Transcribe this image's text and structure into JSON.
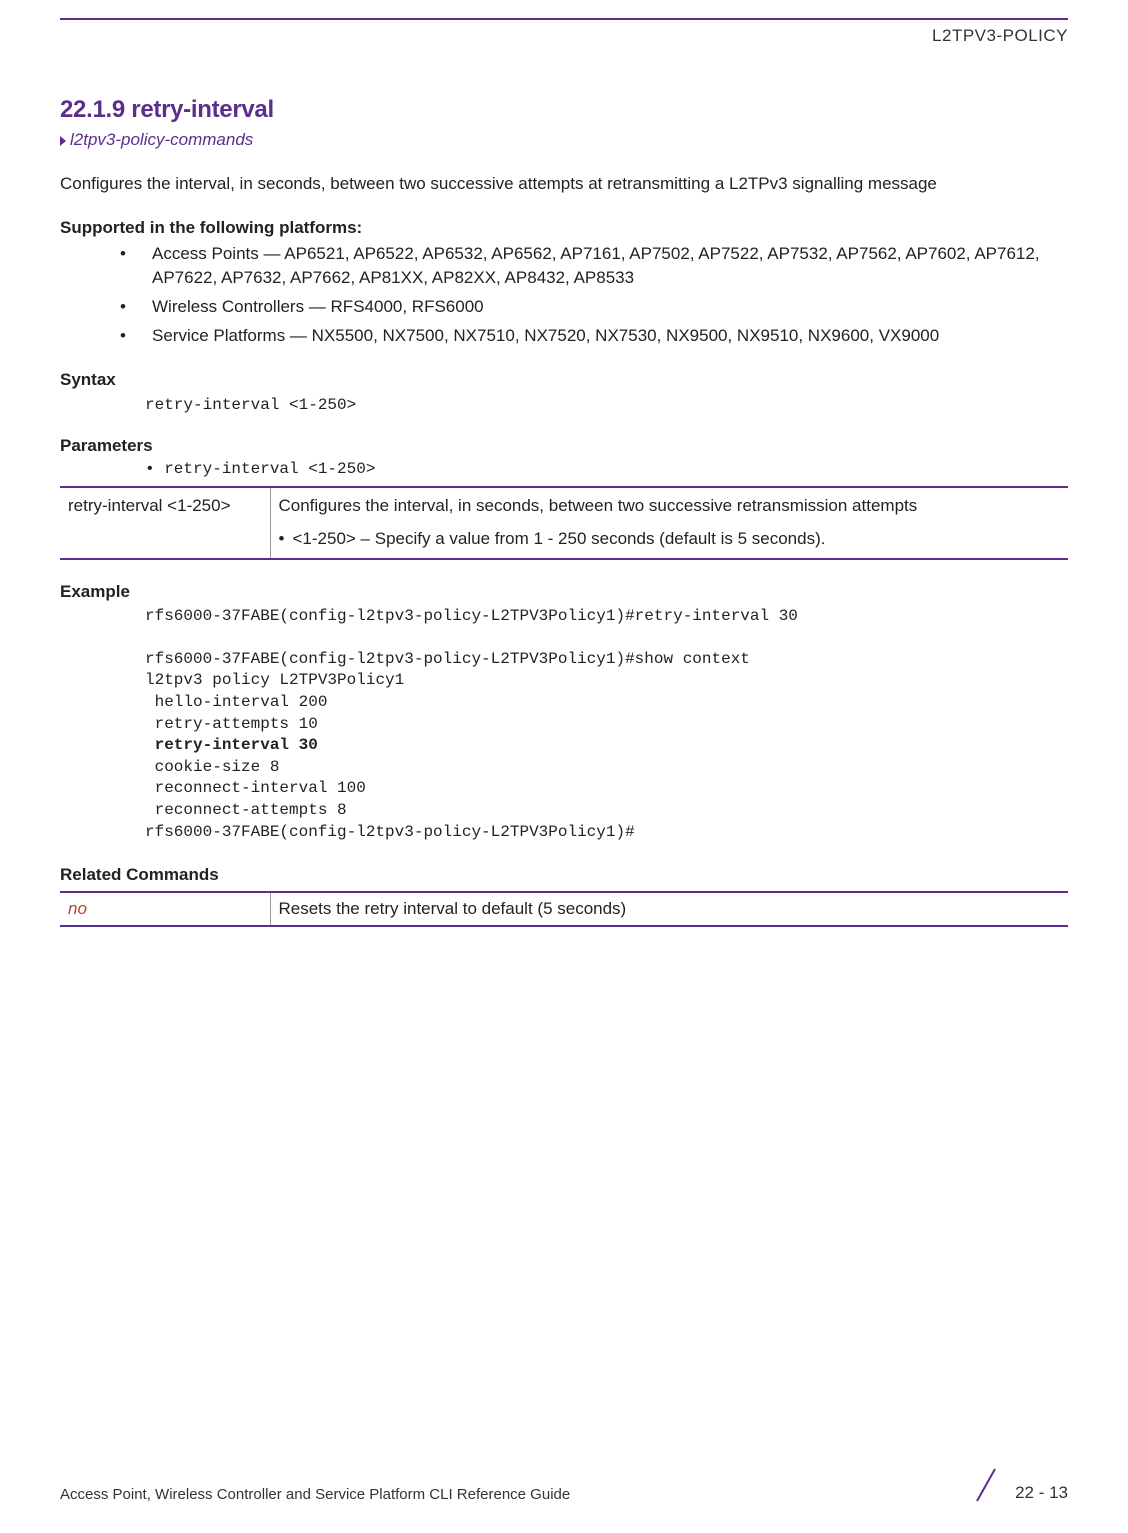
{
  "header": {
    "label": "L2TPV3-POLICY"
  },
  "section": {
    "number_title": "22.1.9 retry-interval",
    "breadcrumb": "l2tpv3-policy-commands",
    "intro": "Configures the interval, in seconds, between two successive attempts at retransmitting a L2TPv3 signalling message"
  },
  "platforms": {
    "heading": "Supported in the following platforms:",
    "items": [
      "Access Points — AP6521, AP6522, AP6532, AP6562, AP7161, AP7502, AP7522, AP7532, AP7562, AP7602, AP7612, AP7622, AP7632, AP7662, AP81XX, AP82XX, AP8432, AP8533",
      "Wireless Controllers — RFS4000, RFS6000",
      "Service Platforms — NX5500, NX7500, NX7510, NX7520, NX7530, NX9500, NX9510, NX9600, VX9000"
    ]
  },
  "syntax": {
    "heading": "Syntax",
    "line": "retry-interval <1-250>"
  },
  "parameters": {
    "heading": "Parameters",
    "bullet": "• retry-interval <1-250>",
    "table": {
      "left": "retry-interval <1-250>",
      "right_desc": "Configures the interval, in seconds, between two successive retransmission attempts",
      "right_bullet": "<1-250> – Specify a value from 1 - 250 seconds (default is 5 seconds)."
    }
  },
  "example": {
    "heading": "Example",
    "line1": "rfs6000-37FABE(config-l2tpv3-policy-L2TPV3Policy1)#retry-interval 30",
    "line2": "rfs6000-37FABE(config-l2tpv3-policy-L2TPV3Policy1)#show context",
    "line3": "l2tpv3 policy L2TPV3Policy1",
    "line4": " hello-interval 200",
    "line5": " retry-attempts 10",
    "line6_bold": " retry-interval 30",
    "line7": " cookie-size 8",
    "line8": " reconnect-interval 100",
    "line9": " reconnect-attempts 8",
    "line10": "rfs6000-37FABE(config-l2tpv3-policy-L2TPV3Policy1)#"
  },
  "related": {
    "heading": "Related Commands",
    "table": {
      "left": "no",
      "right": "Resets the retry interval to default (5 seconds)"
    }
  },
  "footer": {
    "left": "Access Point, Wireless Controller and Service Platform CLI Reference Guide",
    "page": "22 - 13"
  }
}
